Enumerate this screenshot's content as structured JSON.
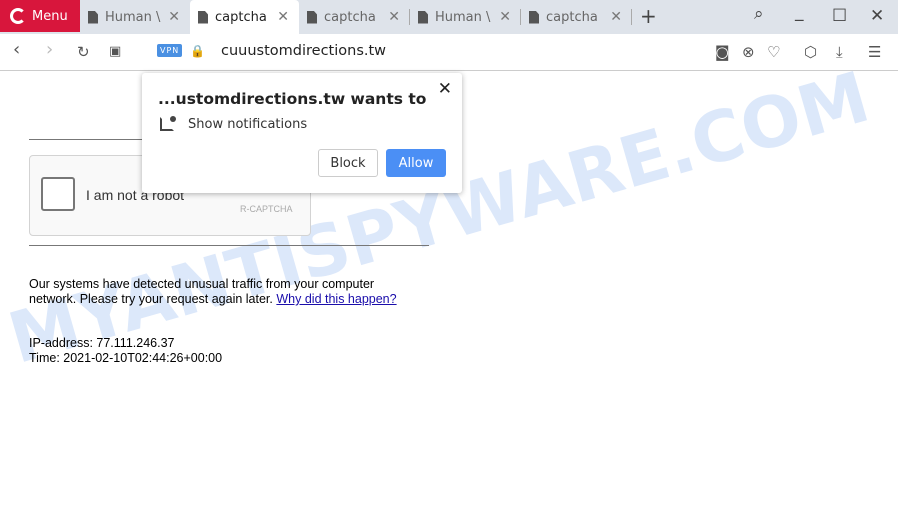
{
  "browser": {
    "menu_label": "Menu",
    "tabs": [
      {
        "label": "Human \\"
      },
      {
        "label": "captcha"
      },
      {
        "label": "captcha"
      },
      {
        "label": "Human \\"
      },
      {
        "label": "captcha"
      }
    ],
    "url": "cuuustomdirections.tw",
    "vpn_label": "VPN",
    "accent": "#d8163c"
  },
  "popup": {
    "title": "...ustomdirections.tw wants to",
    "permission": "Show notifications",
    "block_label": "Block",
    "allow_label": "Allow",
    "allow_color": "#4b8ff5"
  },
  "page": {
    "captcha_label": "I am not a robot",
    "captcha_brand": "R-CAPTCHA",
    "message": "Our systems have detected unusual traffic from your computer",
    "message2": "network. Please try your request again later.",
    "link": "Why did this happen?",
    "ip": "IP-address: 77.111.246.37",
    "time": "Time: 2021-02-10T02:44:26+00:00"
  },
  "watermark": "MYANTISPYWARE.COM"
}
